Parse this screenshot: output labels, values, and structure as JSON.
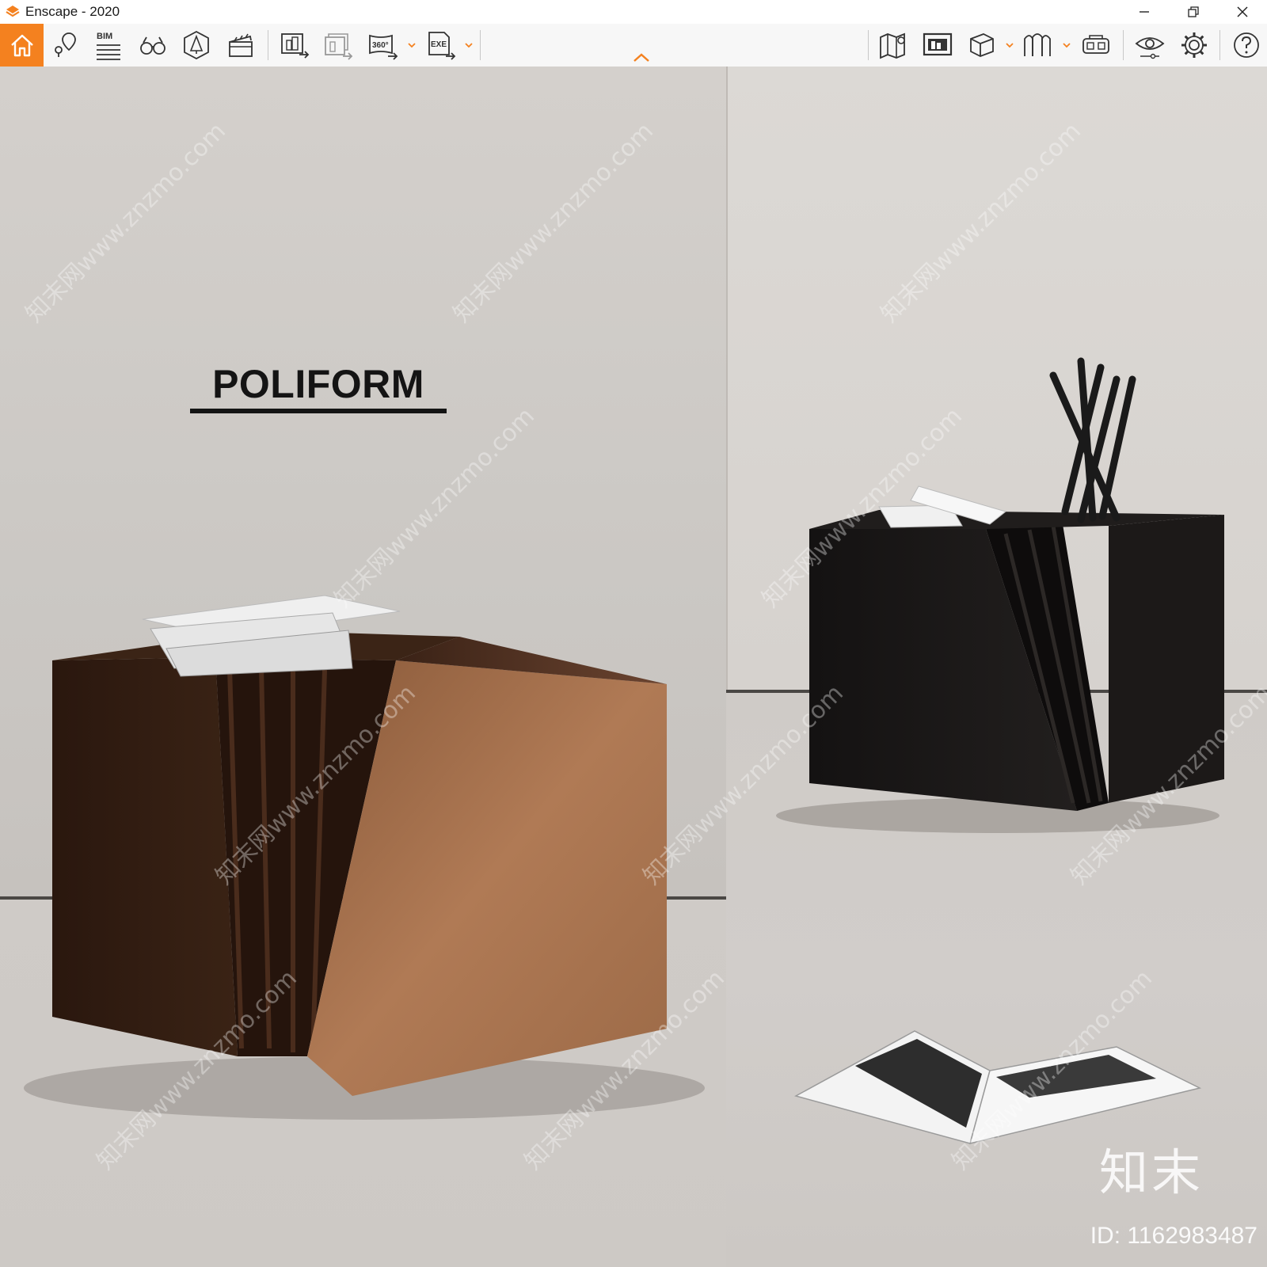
{
  "window": {
    "title": "Enscape - 2020",
    "controls": [
      "minimize-icon",
      "restore-icon",
      "close-icon"
    ]
  },
  "toolbar": {
    "accent_color": "#f4811f",
    "left_tools": [
      {
        "name": "home-button",
        "icon": "home-icon"
      },
      {
        "name": "views-button",
        "icon": "location-pin-icon"
      },
      {
        "name": "bim-button",
        "icon": "bim-list-icon",
        "label": "BIM"
      },
      {
        "name": "binoculars-button",
        "icon": "binoculars-icon"
      },
      {
        "name": "asset-library-button",
        "icon": "asset-library-icon"
      },
      {
        "name": "video-editor-button",
        "icon": "clapperboard-icon"
      },
      {
        "name": "render-image-button",
        "icon": "render-image-icon"
      },
      {
        "name": "batch-render-button",
        "icon": "batch-render-icon"
      },
      {
        "name": "panorama-button",
        "icon": "panorama-360-icon",
        "label": "360°"
      },
      {
        "name": "export-exe-button",
        "icon": "export-exe-icon",
        "label": "EXE"
      }
    ],
    "right_tools": [
      {
        "name": "map-button",
        "icon": "map-icon"
      },
      {
        "name": "web-standalone-button",
        "icon": "monitor-building-icon"
      },
      {
        "name": "view-mode-button",
        "icon": "cube-icon"
      },
      {
        "name": "synchronize-button",
        "icon": "sync-icon"
      },
      {
        "name": "vr-headset-button",
        "icon": "vr-headset-icon"
      },
      {
        "name": "visual-settings-button",
        "icon": "eye-icon"
      },
      {
        "name": "settings-button",
        "icon": "gear-icon"
      },
      {
        "name": "help-button",
        "icon": "help-icon"
      }
    ]
  },
  "scene": {
    "brand_text": "POLIFORM",
    "watermark_text": "知末网www.znzmo.com",
    "logo_text": "知末",
    "id_text": "ID: 1162983487"
  }
}
